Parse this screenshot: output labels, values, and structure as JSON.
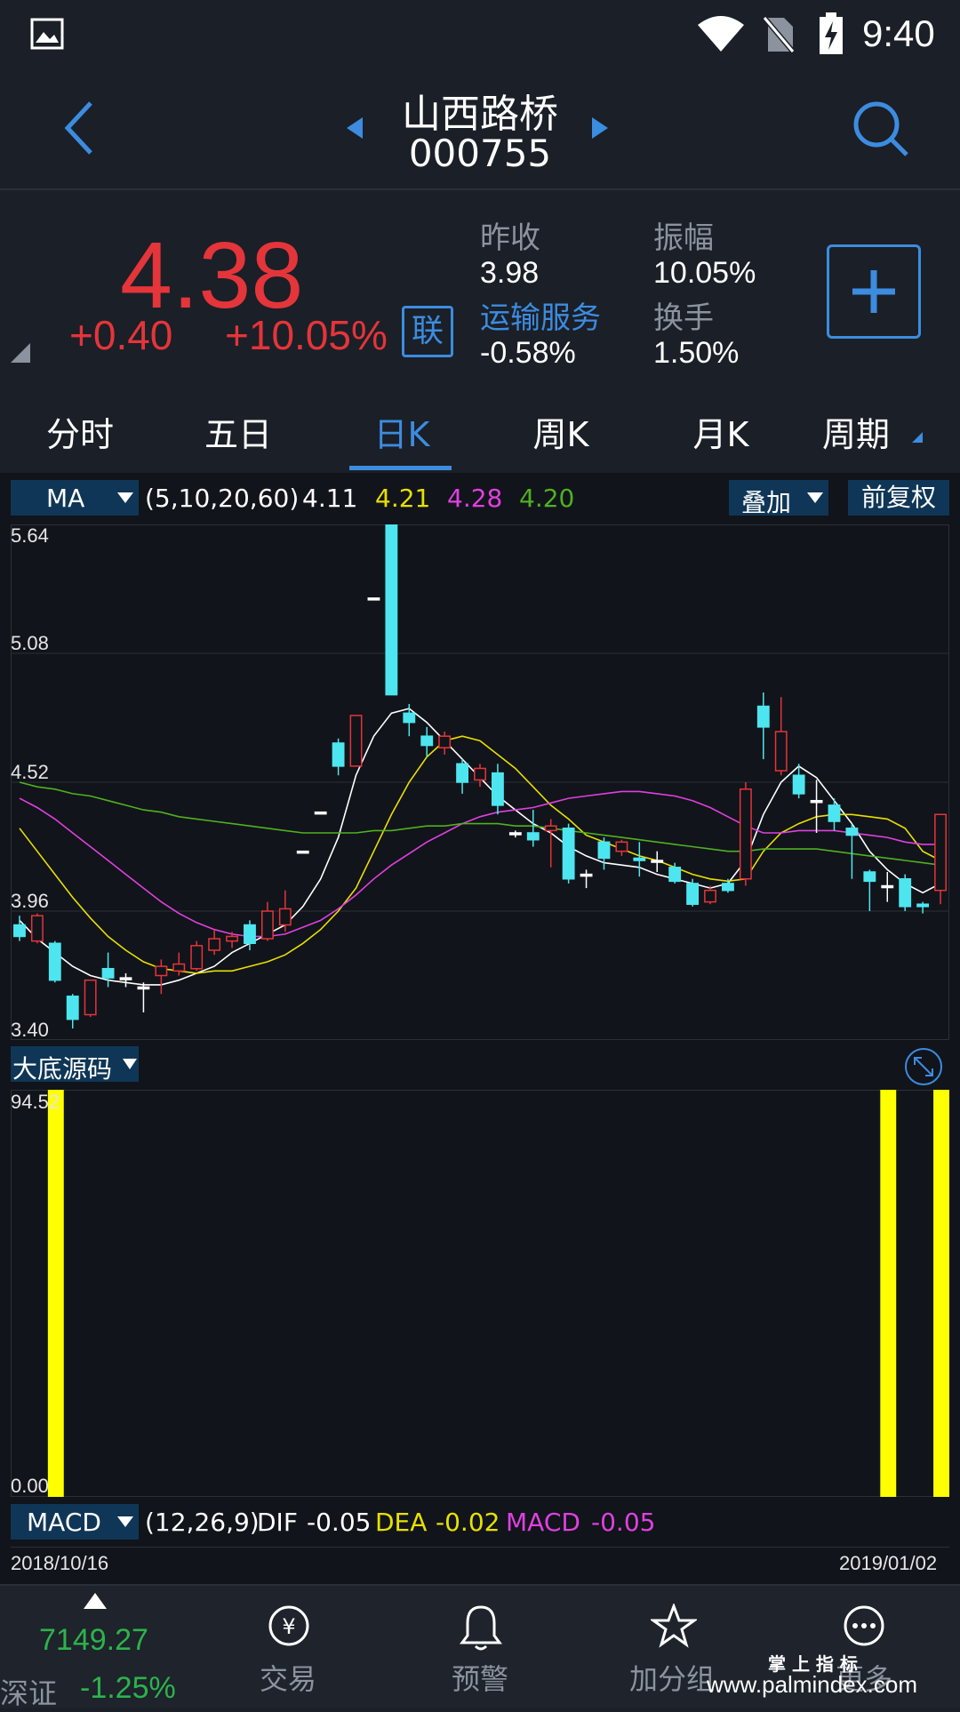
{
  "status_bar": {
    "time": "9:40"
  },
  "header": {
    "stock_name": "山西路桥",
    "stock_code": "000755"
  },
  "quote": {
    "price": "4.38",
    "change": "+0.40",
    "change_pct": "+10.05%",
    "lian_badge": "联",
    "prev_close_label": "昨收",
    "prev_close": "3.98",
    "amplitude_label": "振幅",
    "amplitude": "10.05%",
    "sector_label": "运输服务",
    "sector_change": "-0.58%",
    "turnover_label": "换手",
    "turnover": "1.50%",
    "colors": {
      "up": "#e4353a",
      "accent": "#3c8ce0"
    }
  },
  "tabs": [
    {
      "label": "分时"
    },
    {
      "label": "五日"
    },
    {
      "label": "日K",
      "active": true
    },
    {
      "label": "周K"
    },
    {
      "label": "月K"
    },
    {
      "label": "周期"
    }
  ],
  "ma_bar": {
    "indicator": "MA",
    "params": "(5,10,20,60)",
    "ma5": "4.11",
    "ma10": "4.21",
    "ma20": "4.28",
    "ma60": "4.20",
    "overlay_label": "叠加",
    "adjust_label": "前复权",
    "colors": {
      "ma5": "#ffffff",
      "ma10": "#e8e000",
      "ma20": "#e040e0",
      "ma60": "#50b020"
    }
  },
  "chart_data": [
    {
      "type": "candlestick",
      "title": "",
      "y_ticks": [
        "5.64",
        "5.08",
        "4.52",
        "3.96",
        "3.40"
      ],
      "ylim": [
        3.4,
        5.64
      ],
      "x_start": "2018/10/16",
      "x_end": "2019/01/02",
      "colors": {
        "up": "#e4353a",
        "down": "#4de6f0",
        "flat": "#ffffff"
      },
      "candles": [
        {
          "o": 3.9,
          "c": 3.85,
          "h": 3.94,
          "l": 3.83
        },
        {
          "o": 3.83,
          "c": 3.94,
          "h": 3.95,
          "l": 3.82
        },
        {
          "o": 3.82,
          "c": 3.66,
          "h": 3.83,
          "l": 3.65
        },
        {
          "o": 3.59,
          "c": 3.49,
          "h": 3.6,
          "l": 3.45
        },
        {
          "o": 3.51,
          "c": 3.66,
          "h": 3.66,
          "l": 3.5
        },
        {
          "o": 3.71,
          "c": 3.67,
          "h": 3.78,
          "l": 3.63
        },
        {
          "o": 3.67,
          "c": 3.67,
          "h": 3.69,
          "l": 3.63
        },
        {
          "o": 3.63,
          "c": 3.63,
          "h": 3.65,
          "l": 3.52
        },
        {
          "o": 3.68,
          "c": 3.72,
          "h": 3.75,
          "l": 3.6
        },
        {
          "o": 3.7,
          "c": 3.73,
          "h": 3.78,
          "l": 3.68
        },
        {
          "o": 3.71,
          "c": 3.81,
          "h": 3.83,
          "l": 3.7
        },
        {
          "o": 3.79,
          "c": 3.84,
          "h": 3.88,
          "l": 3.77
        },
        {
          "o": 3.83,
          "c": 3.85,
          "h": 3.87,
          "l": 3.8
        },
        {
          "o": 3.9,
          "c": 3.82,
          "h": 3.92,
          "l": 3.79
        },
        {
          "o": 3.84,
          "c": 3.96,
          "h": 4.0,
          "l": 3.83
        },
        {
          "o": 3.9,
          "c": 3.97,
          "h": 4.05,
          "l": 3.87
        },
        {
          "o": 4.22,
          "c": 4.22,
          "h": 4.22,
          "l": 4.22
        },
        {
          "o": 4.39,
          "c": 4.39,
          "h": 4.39,
          "l": 4.39
        },
        {
          "o": 4.69,
          "c": 4.59,
          "h": 4.71,
          "l": 4.55
        },
        {
          "o": 4.59,
          "c": 4.81,
          "h": 4.81,
          "l": 4.59
        },
        {
          "o": 5.32,
          "c": 5.32,
          "h": 5.32,
          "l": 5.32
        },
        {
          "o": 5.64,
          "c": 4.9,
          "h": 5.64,
          "l": 4.9
        },
        {
          "o": 4.82,
          "c": 4.78,
          "h": 4.86,
          "l": 4.72
        },
        {
          "o": 4.72,
          "c": 4.68,
          "h": 4.76,
          "l": 4.63
        },
        {
          "o": 4.67,
          "c": 4.72,
          "h": 4.74,
          "l": 4.64
        },
        {
          "o": 4.6,
          "c": 4.52,
          "h": 4.62,
          "l": 4.47
        },
        {
          "o": 4.53,
          "c": 4.58,
          "h": 4.6,
          "l": 4.5
        },
        {
          "o": 4.56,
          "c": 4.42,
          "h": 4.6,
          "l": 4.38
        },
        {
          "o": 4.3,
          "c": 4.3,
          "h": 4.31,
          "l": 4.28
        },
        {
          "o": 4.3,
          "c": 4.27,
          "h": 4.4,
          "l": 4.24
        },
        {
          "o": 4.31,
          "c": 4.33,
          "h": 4.36,
          "l": 4.15
        },
        {
          "o": 4.32,
          "c": 4.1,
          "h": 4.34,
          "l": 4.08
        },
        {
          "o": 4.12,
          "c": 4.12,
          "h": 4.14,
          "l": 4.06
        },
        {
          "o": 4.26,
          "c": 4.19,
          "h": 4.28,
          "l": 4.14
        },
        {
          "o": 4.22,
          "c": 4.26,
          "h": 4.27,
          "l": 4.2
        },
        {
          "o": 4.19,
          "c": 4.18,
          "h": 4.26,
          "l": 4.11
        },
        {
          "o": 4.18,
          "c": 4.18,
          "h": 4.22,
          "l": 4.13
        },
        {
          "o": 4.15,
          "c": 4.09,
          "h": 4.17,
          "l": 4.08
        },
        {
          "o": 4.08,
          "c": 3.99,
          "h": 4.1,
          "l": 3.98
        },
        {
          "o": 4.0,
          "c": 4.05,
          "h": 4.07,
          "l": 3.99
        },
        {
          "o": 4.08,
          "c": 4.05,
          "h": 4.1,
          "l": 4.04
        },
        {
          "o": 4.1,
          "c": 4.49,
          "h": 4.52,
          "l": 4.07
        },
        {
          "o": 4.85,
          "c": 4.76,
          "h": 4.91,
          "l": 4.62
        },
        {
          "o": 4.57,
          "c": 4.74,
          "h": 4.89,
          "l": 4.55
        },
        {
          "o": 4.55,
          "c": 4.47,
          "h": 4.6,
          "l": 4.45
        },
        {
          "o": 4.44,
          "c": 4.44,
          "h": 4.53,
          "l": 4.3
        },
        {
          "o": 4.42,
          "c": 4.35,
          "h": 4.45,
          "l": 4.31
        },
        {
          "o": 4.32,
          "c": 4.29,
          "h": 4.34,
          "l": 4.1
        },
        {
          "o": 4.13,
          "c": 4.09,
          "h": 4.14,
          "l": 3.96
        },
        {
          "o": 4.07,
          "c": 4.07,
          "h": 4.13,
          "l": 4.0
        },
        {
          "o": 4.1,
          "c": 3.98,
          "h": 4.12,
          "l": 3.96
        },
        {
          "o": 3.99,
          "c": 3.98,
          "h": 4.0,
          "l": 3.95
        },
        {
          "o": 4.05,
          "c": 4.38,
          "h": 4.38,
          "l": 3.99
        }
      ],
      "ma_lines": {
        "ma5": [
          3.92,
          3.84,
          3.78,
          3.72,
          3.68,
          3.66,
          3.65,
          3.64,
          3.64,
          3.66,
          3.69,
          3.72,
          3.78,
          3.82,
          3.86,
          3.9,
          3.98,
          4.1,
          4.28,
          4.55,
          4.72,
          4.82,
          4.84,
          4.78,
          4.7,
          4.62,
          4.54,
          4.46,
          4.4,
          4.34,
          4.3,
          4.24,
          4.2,
          4.17,
          4.16,
          4.15,
          4.12,
          4.1,
          4.08,
          4.06,
          4.08,
          4.18,
          4.38,
          4.52,
          4.59,
          4.54,
          4.44,
          4.34,
          4.22,
          4.14,
          4.08,
          4.04,
          4.08
        ],
        "ma10": [
          4.32,
          4.22,
          4.12,
          4.02,
          3.93,
          3.85,
          3.79,
          3.74,
          3.71,
          3.7,
          3.69,
          3.7,
          3.7,
          3.72,
          3.74,
          3.77,
          3.82,
          3.88,
          3.96,
          4.06,
          4.22,
          4.38,
          4.52,
          4.63,
          4.7,
          4.72,
          4.7,
          4.64,
          4.58,
          4.5,
          4.42,
          4.36,
          4.29,
          4.26,
          4.23,
          4.2,
          4.18,
          4.15,
          4.12,
          4.1,
          4.09,
          4.1,
          4.22,
          4.3,
          4.34,
          4.37,
          4.38,
          4.38,
          4.37,
          4.36,
          4.32,
          4.22,
          4.18
        ],
        "ma20": [
          4.45,
          4.41,
          4.36,
          4.3,
          4.24,
          4.18,
          4.12,
          4.06,
          4.0,
          3.95,
          3.91,
          3.88,
          3.86,
          3.85,
          3.85,
          3.86,
          3.89,
          3.92,
          3.97,
          4.03,
          4.1,
          4.16,
          4.21,
          4.26,
          4.3,
          4.34,
          4.37,
          4.39,
          4.4,
          4.41,
          4.43,
          4.45,
          4.46,
          4.47,
          4.48,
          4.48,
          4.47,
          4.46,
          4.44,
          4.41,
          4.37,
          4.33,
          4.3,
          4.3,
          4.31,
          4.31,
          4.31,
          4.3,
          4.29,
          4.28,
          4.26,
          4.25,
          4.25
        ],
        "ma60": [
          4.52,
          4.5,
          4.49,
          4.47,
          4.46,
          4.44,
          4.42,
          4.4,
          4.39,
          4.37,
          4.36,
          4.35,
          4.34,
          4.33,
          4.32,
          4.31,
          4.3,
          4.3,
          4.3,
          4.3,
          4.31,
          4.31,
          4.32,
          4.33,
          4.33,
          4.34,
          4.34,
          4.34,
          4.33,
          4.33,
          4.32,
          4.31,
          4.3,
          4.29,
          4.28,
          4.27,
          4.26,
          4.25,
          4.24,
          4.23,
          4.22,
          4.22,
          4.23,
          4.23,
          4.23,
          4.23,
          4.22,
          4.21,
          4.2,
          4.19,
          4.18,
          4.17,
          4.16
        ]
      }
    },
    {
      "type": "bar",
      "title": "大底源码",
      "y_ticks": [
        "94.52",
        "0.00"
      ],
      "ylim": [
        0,
        94.52
      ],
      "bar_color": "#ffff00",
      "signal_bars": [
        2,
        49,
        52
      ],
      "bar_count": 53
    }
  ],
  "indicator_panel": {
    "name": "大底源码"
  },
  "macd_bar": {
    "indicator": "MACD",
    "params": "(12,26,9)",
    "dif_label": "DIF",
    "dif": "-0.05",
    "dea_label": "DEA",
    "dea": "-0.02",
    "macd_label": "MACD",
    "macd": "-0.05"
  },
  "dates": {
    "start": "2018/10/16",
    "end": "2019/01/02"
  },
  "bottom_nav": {
    "index_value": "7149.27",
    "index_name": "深证",
    "index_change": "-1.25%",
    "items": [
      {
        "label": "交易",
        "icon": "yen-exchange-icon"
      },
      {
        "label": "预警",
        "icon": "bell-icon"
      },
      {
        "label": "加分组",
        "icon": "star-icon"
      },
      {
        "label": "更多",
        "icon": "more-icon"
      }
    ]
  },
  "watermark": {
    "line1": "掌 上 指 标",
    "line2": "www.palmindex.com"
  }
}
